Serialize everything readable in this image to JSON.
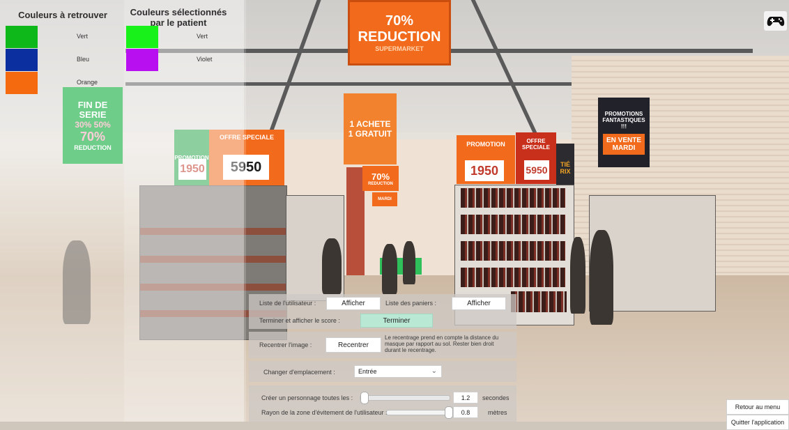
{
  "left_panel": {
    "target_title": "Couleurs à retrouver",
    "selected_title": "Couleurs sélectionnés par le patient",
    "target_colors": [
      {
        "label": "Vert",
        "color": "#0fb81a"
      },
      {
        "label": "Bleu",
        "color": "#0b2f9e"
      },
      {
        "label": "Orange",
        "color": "#f56a0e"
      }
    ],
    "selected_colors": [
      {
        "label": "Vert",
        "color": "#19f21a"
      },
      {
        "label": "Violet",
        "color": "#b80ff0"
      }
    ]
  },
  "controls": {
    "user_list_label": "Liste de l'utilisateur :",
    "user_list_button": "Afficher",
    "baskets_label": "Liste des paniers :",
    "baskets_button": "Afficher",
    "finish_label": "Terminer et afficher le score :",
    "finish_button": "Terminer",
    "recenter_label": "Recentrer l'image :",
    "recenter_button": "Recentrer",
    "recenter_help": "Le recentrage prend en compte la distance du masque par rapport au sol. Rester bien droit durant le recentrage.",
    "location_label": "Changer d'emplacement :",
    "location_value": "Entrée",
    "spawn_label": "Créer un personnage toutes les :",
    "spawn_value": "1.2",
    "spawn_unit": "secondes",
    "spawn_level": 0.0,
    "avoid_label": "Rayon de la zone d'évitement de l'utilisateur :",
    "avoid_value": "0.8",
    "avoid_unit": "mètres",
    "avoid_level": 1.0
  },
  "bottom": {
    "menu_button": "Retour au menu",
    "quit_button": "Quitter l'application"
  },
  "scene_signs": {
    "top_reduction": "REDUCTION",
    "top_percent": "70%",
    "top_market": "SUPERMARKET",
    "fin_de_serie": "FIN DE SERIE",
    "fin_percents": "30% 50%",
    "fin_percent_big": "70%",
    "fin_reduction": "REDUCTION",
    "promo_left": "PROMOTION",
    "offre_left": "OFFRE SPECIALE",
    "price_1950": "1950",
    "price_5950": "5950",
    "achete": "1 ACHETE",
    "gratuit": "1 GRATUIT",
    "mid_70": "70%",
    "mid_reduction": "REDUCTION",
    "mardi_small": "MARDI",
    "promo_right": "PROMOTION",
    "offre_right": "OFFRE SPECIALE",
    "price_1950_r": "1950",
    "price_5950_r": "5950",
    "moitie": "TIÉ RIX",
    "promos_fantastiques": "PROMOTIONS FANTASTIQUES !!!",
    "en_vente": "EN VENTE MARDI"
  }
}
